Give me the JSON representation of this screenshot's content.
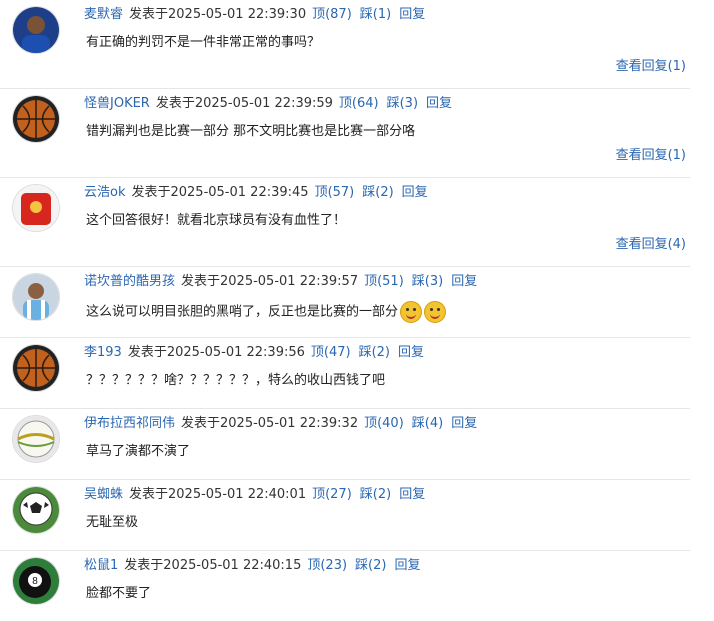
{
  "comments": [
    {
      "user": "麦默睿",
      "time": "发表于2025-05-01 22:39:30",
      "up": "顶(87)",
      "down": "踩(1)",
      "reply": "回复",
      "text": "有正确的判罚不是一件非常正常的事吗？",
      "more": "查看回复(1)",
      "avatar": "player-photo"
    },
    {
      "user": "怪兽JOKER",
      "time": "发表于2025-05-01 22:39:59",
      "up": "顶(64)",
      "down": "踩(3)",
      "reply": "回复",
      "text": "错判漏判也是比赛一部分 那不文明比赛也是比赛一部分咯",
      "more": "查看回复(1)",
      "avatar": "basketball"
    },
    {
      "user": "云浩ok",
      "time": "发表于2025-05-01 22:39:45",
      "up": "顶(57)",
      "down": "踩(2)",
      "reply": "回复",
      "text": "这个回答很好！就看北京球员有没有血性了！",
      "more": "查看回复(4)",
      "avatar": "red-envelope"
    },
    {
      "user": "诺坎普的酷男孩",
      "time": "发表于2025-05-01 22:39:57",
      "up": "顶(51)",
      "down": "踩(3)",
      "reply": "回复",
      "text": "这么说可以明目张胆的黑哨了，反正也是比赛的一部分",
      "more": "",
      "avatar": "player-photo-2"
    },
    {
      "user": "李193",
      "time": "发表于2025-05-01 22:39:56",
      "up": "顶(47)",
      "down": "踩(2)",
      "reply": "回复",
      "text": "？？？？？？啥？？？？？？，特么的收山西钱了吧",
      "more": "",
      "avatar": "basketball"
    },
    {
      "user": "伊布拉西祁同伟",
      "time": "发表于2025-05-01 22:39:32",
      "up": "顶(40)",
      "down": "踩(4)",
      "reply": "回复",
      "text": "草马了演都不演了",
      "more": "",
      "avatar": "ball-white"
    },
    {
      "user": "吴蜘蛛",
      "time": "发表于2025-05-01 22:40:01",
      "up": "顶(27)",
      "down": "踩(2)",
      "reply": "回复",
      "text": "无耻至极",
      "more": "",
      "avatar": "soccer-ball"
    },
    {
      "user": "松鼠1",
      "time": "发表于2025-05-01 22:40:15",
      "up": "顶(23)",
      "down": "踩(2)",
      "reply": "回复",
      "text": "脸都不要了",
      "more": "",
      "avatar": "billiard-8-ball"
    }
  ]
}
